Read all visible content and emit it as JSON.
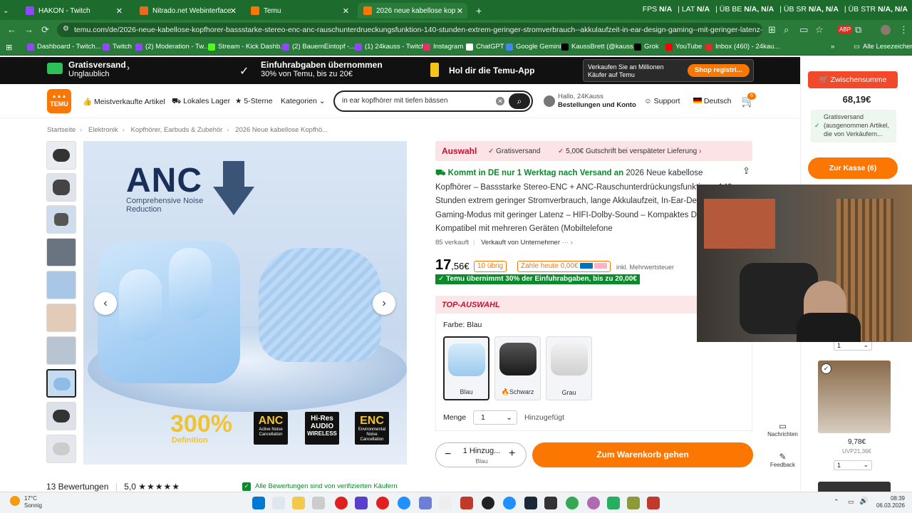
{
  "browser": {
    "tabs": [
      {
        "label": "HAKON - Twitch",
        "fav_color": "#9146ff"
      },
      {
        "label": "Nitrado.net Webinterface",
        "fav_color": "#e66b22"
      },
      {
        "label": "Temu",
        "fav_color": "#fb7701"
      },
      {
        "label": "2026 neue kabellose kopfhörer",
        "fav_color": "#fb7701"
      }
    ],
    "new_tab": "+",
    "stats": [
      {
        "k": "FPS",
        "v": "N/A"
      },
      {
        "k": "LAT",
        "v": "N/A"
      },
      {
        "k": "ÜB BE",
        "v": "N/A, N/A"
      },
      {
        "k": "ÜB SR",
        "v": "N/A, N/A"
      },
      {
        "k": "ÜB STR",
        "v": "N/A, N/A"
      }
    ],
    "url": "temu.com/de/2026-neue-kabellose-kopfhorer-bassstarke-stereo-enc-anc-rauschunterdrueckungsfunktion-140-stunden-extrem-geringer-stromverbrauch--akkulaufzeit-in-ear-design-gaming--mit-geringer-latenz-hifi--sound-kompakt...",
    "bookmarks": [
      {
        "label": "Dashboard - Twitch...",
        "color": "#9146ff"
      },
      {
        "label": "Twitch",
        "color": "#9146ff"
      },
      {
        "label": "(2) Moderation - Tw...",
        "color": "#9146ff"
      },
      {
        "label": "Stream - Kick Dashb...",
        "color": "#53fc18"
      },
      {
        "label": "(2) BauernEintopf -...",
        "color": "#9146ff"
      },
      {
        "label": "(1) 24kauss - Twitch",
        "color": "#9146ff"
      },
      {
        "label": "Instagram",
        "color": "#e1306c"
      },
      {
        "label": "ChatGPT",
        "color": "#ffffff"
      },
      {
        "label": "Google Gemini",
        "color": "#4285f4"
      },
      {
        "label": "KaussBrett (@kauss...",
        "color": "#000000"
      },
      {
        "label": "Grok",
        "color": "#000000"
      },
      {
        "label": "YouTube",
        "color": "#ff0000"
      },
      {
        "label": "Inbox (460) - 24kau...",
        "color": "#d93025"
      }
    ],
    "all_bookmarks": "Alle Lesezeichen"
  },
  "promo": {
    "free_ship_title": "Gratisversand",
    "free_ship_sub": "Unglaublich",
    "import_title": "Einfuhrabgaben übernommen",
    "import_sub": "30% von Temu, bis zu 20€",
    "app": "Hol dir die Temu-App",
    "sell_text": "Verkaufen Sie an Millionen Käufer auf Temu",
    "sell_btn": "Shop registri..."
  },
  "header": {
    "logo": "TEMU",
    "nav": [
      "Meistverkaufte Artikel",
      "Lokales Lager",
      "5-Sterne",
      "Kategorien"
    ],
    "search_value": "in ear kopfhörer mit tiefen bässen",
    "account_greeting": "Hallo, 24Kauss",
    "account_link": "Bestellungen und Konto",
    "support": "Support",
    "language": "Deutsch",
    "cart_count": "6"
  },
  "breadcrumb": [
    "Startseite",
    "Elektronik",
    "Kopfhörer, Earbuds & Zubehör",
    "2026 Neue kabellose Kopfhö..."
  ],
  "product": {
    "image_badges": {
      "anc_big": "ANC",
      "anc_sub": "Comprehensive Noise Reduction",
      "pct": "300%",
      "pct_sub": "Definition",
      "b1": "ANC",
      "b1s": "Active Noise Cancellation",
      "b2": "Hi-Res AUDIO",
      "b2s": "WIRELESS",
      "b3": "ENC",
      "b3s": "Environmental Noise Cancellation"
    },
    "auswahl": "Auswahl",
    "auswahl_1": "Gratisversand",
    "auswahl_2": "5,00€ Gutschrift bei verspäteter Lieferung",
    "arrival": "Kommt in DE nur 1 Werktag nach Versand an",
    "title": "2026 Neue kabellose Kopfhörer – Bassstarke Stereo-ENC + ANC-Rauschunterdrückungsfunktion – 140 Stunden extrem geringer Stromverbrauch, lange Akkulaufzeit, In-Ear-Design – Gaming-Modus mit geringer Latenz – HIFI-Dolby-Sound – Kompaktes Design – Kompatibel mit mehreren Geräten (Mobiltelefone",
    "sold": "85 verkauft",
    "seller": "Verkauft von Unternehmer",
    "price_main": "17",
    "price_frac": ",56€",
    "left": "10 übrig",
    "pay_today": "Zahle heute 0,00€",
    "tax": "inkl. Mehrwertsteuer",
    "import_banner": "✓ Temu übernimmt 30% der Einfuhrabgaben, bis zu 20,00€",
    "top_title": "TOP-AUSWAHL",
    "color_label": "Farbe: Blau",
    "swatches": [
      "Blau",
      "Schwarz",
      "Grau"
    ],
    "qty_label": "Menge",
    "qty_value": "1",
    "added": "Hinzugefügt",
    "add_btn": "1 Hinzug...",
    "add_btn_sub": "Blau",
    "to_cart": "Zum Warenkorb gehen",
    "reviews": "13 Bewertungen",
    "rating": "5,0",
    "verified": "Alle Bewertungen sind von verifizierten Käufern"
  },
  "sidebar": {
    "subtotal_btn": "Zwischensumme",
    "subtotal": "68,19€",
    "ship_note": "Gratisversand (ausgenommen Artikel, die von Verkäufern...",
    "checkout": "Zur Kasse (6)",
    "item_qty": "1",
    "item2_price": "9,78€",
    "item2_uvp": "UVP21,36€",
    "item2_qty": "1"
  },
  "floating": {
    "messages": "Nachrichten",
    "feedback": "Feedback"
  },
  "taskbar": {
    "temp": "17°C",
    "weather": "Sonnig",
    "time": "08:39",
    "date": "06.03.2026"
  },
  "colors": {
    "temu_orange": "#fb7701",
    "chrome_green": "#2a7a3a",
    "promo_black": "#111111",
    "temu_green": "#0a8a2a",
    "highlight_red": "#c8102e"
  }
}
